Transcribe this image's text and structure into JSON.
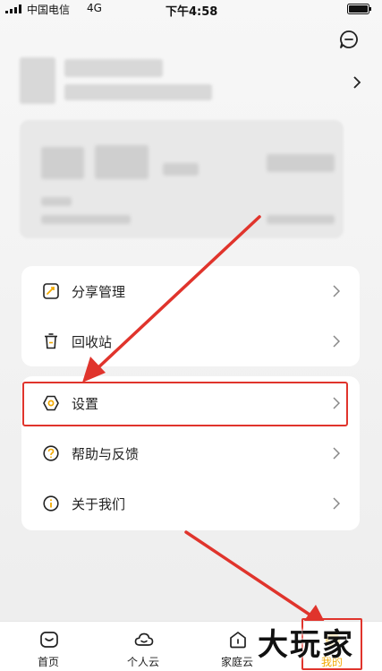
{
  "status_bar": {
    "carrier": "中国电信",
    "network": "4G",
    "time": "下午4:58"
  },
  "menu": {
    "panel1": [
      {
        "label": "分享管理",
        "icon": "share-manage-icon"
      },
      {
        "label": "回收站",
        "icon": "trash-icon"
      }
    ],
    "settings": {
      "label": "设置",
      "icon": "settings-hex-icon"
    },
    "panel2": [
      {
        "label": "帮助与反馈",
        "icon": "help-icon"
      },
      {
        "label": "关于我们",
        "icon": "info-icon"
      }
    ]
  },
  "tabbar": {
    "home": "首页",
    "personal_cloud": "个人云",
    "family_cloud": "家庭云",
    "mine": "我的"
  },
  "watermark": "大玩家",
  "colors": {
    "accent": "#f2a900",
    "annotation": "#e0342c"
  }
}
